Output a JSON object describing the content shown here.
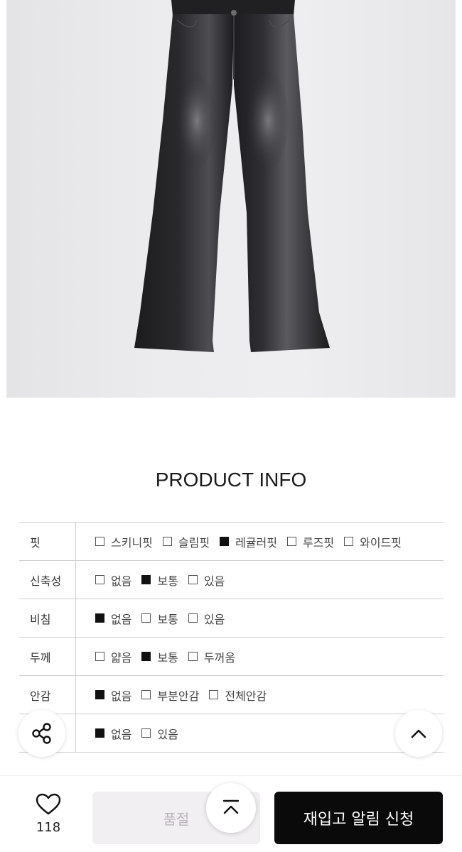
{
  "product_info": {
    "title": "PRODUCT INFO",
    "rows": [
      {
        "label": "핏",
        "options": [
          {
            "text": "스키니핏",
            "checked": false
          },
          {
            "text": "슬림핏",
            "checked": false
          },
          {
            "text": "레귤러핏",
            "checked": true
          },
          {
            "text": "루즈핏",
            "checked": false
          },
          {
            "text": "와이드핏",
            "checked": false
          }
        ]
      },
      {
        "label": "신축성",
        "options": [
          {
            "text": "없음",
            "checked": false
          },
          {
            "text": "보통",
            "checked": true
          },
          {
            "text": "있음",
            "checked": false
          }
        ]
      },
      {
        "label": "비침",
        "options": [
          {
            "text": "없음",
            "checked": true
          },
          {
            "text": "보통",
            "checked": false
          },
          {
            "text": "있음",
            "checked": false
          }
        ]
      },
      {
        "label": "두께",
        "options": [
          {
            "text": "얇음",
            "checked": false
          },
          {
            "text": "보통",
            "checked": true
          },
          {
            "text": "두꺼움",
            "checked": false
          }
        ]
      },
      {
        "label": "안감",
        "options": [
          {
            "text": "없음",
            "checked": true
          },
          {
            "text": "부분안감",
            "checked": false
          },
          {
            "text": "전체안감",
            "checked": false
          }
        ]
      },
      {
        "label": "",
        "options": [
          {
            "text": "없음",
            "checked": true
          },
          {
            "text": "있음",
            "checked": false
          }
        ]
      }
    ]
  },
  "floating": {
    "share_icon": "share-icon",
    "scroll_up_icon": "chevron-up-icon",
    "scroll_top_icon": "scroll-to-top-icon"
  },
  "bottom_bar": {
    "wish_icon": "heart-icon",
    "wish_count": "118",
    "soldout_label": "품절",
    "restock_label": "재입고 알림 신청"
  },
  "colors": {
    "primary_button": "#0a0a0a",
    "disabled_button": "#f1eff2",
    "checked_box": "#111111"
  }
}
